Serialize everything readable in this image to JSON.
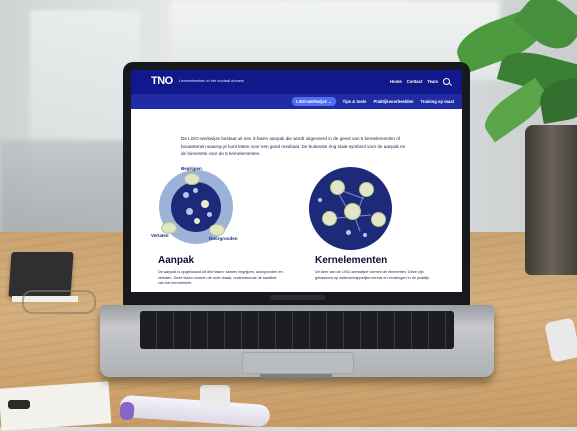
{
  "site": {
    "logo": "TNO",
    "tagline": "Leernetwerken in het sociaal domein",
    "top_nav": [
      "Home",
      "Contact",
      "Team"
    ],
    "sub_nav": [
      {
        "label": "LISO-werkwijze",
        "active": true
      },
      {
        "label": "Tips & tools",
        "active": false
      },
      {
        "label": "Praktijkvoorbeelden",
        "active": false
      },
      {
        "label": "Training op maat",
        "active": false
      }
    ],
    "intro": "De LISO-werkwijze bestaat uit een 3-fasen aanpak die wordt uitgevoerd in de geest van 5 kernelementen of bouwstenen waarop je kunt letten voor een goed resultaat. De buitenste ring staat symbool voor de aanpak en de binnenste voor de 5 kernelementen.",
    "aanpak": {
      "title": "Aanpak",
      "text": "De aanpak is opgebouwd uit drie fasen: samen begrijpen, doorgronden en vertalen. Deze fasen vormen de rode draad, ondersteunde de kwaliteit van het leernetwerk.",
      "ring_labels": [
        "Begrijpen",
        "Vertalen",
        "Doorgronden"
      ]
    },
    "kernelementen": {
      "title": "Kernelementen",
      "text": "De kern van de LISO-werkwijze vormen de elementen. Deze zijn gebaseerd op wetenschappelijke kennis en ervaringen in de praktijk."
    },
    "colors": {
      "header": "#11188c",
      "subnav": "#1f2ca6",
      "active_tab": "#4f6ff2",
      "diagram_dark": "#1d2a7a",
      "diagram_ring": "#9db2d9"
    }
  }
}
